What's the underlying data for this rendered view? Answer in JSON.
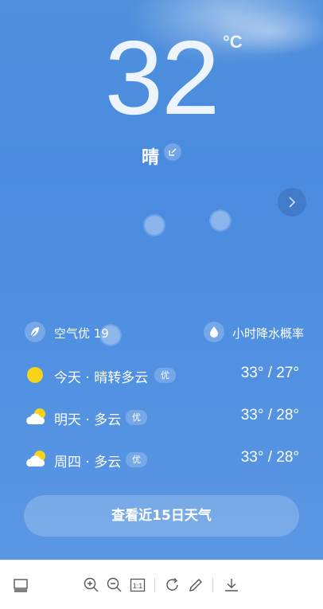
{
  "weather": {
    "temperature": "32",
    "unit": "°C",
    "condition": "晴"
  },
  "info": {
    "air_quality": "空气优 19",
    "precip": "小时降水概率"
  },
  "forecast": [
    {
      "day": "今天 · 晴转多云",
      "badge": "优",
      "range": "33° / 27°",
      "icon": "sun-icon"
    },
    {
      "day": "明天 · 多云",
      "badge": "优",
      "range": "33° / 28°",
      "icon": "partly-cloudy-icon"
    },
    {
      "day": "周四 · 多云",
      "badge": "优",
      "range": "33° / 28°",
      "icon": "partly-cloudy-icon"
    }
  ],
  "forecast_button": "查看近15日天气",
  "toolbar": {
    "icons": [
      "gallery-icon",
      "zoom-in-icon",
      "zoom-out-icon",
      "actual-size-icon",
      "rotate-icon",
      "edit-icon",
      "download-icon"
    ],
    "actual_size_label": "1:1"
  },
  "colors": {
    "sky": "#4a8be0",
    "text": "#ffffff",
    "sun": "#f7d21b",
    "toolbar_icon": "#555555"
  }
}
